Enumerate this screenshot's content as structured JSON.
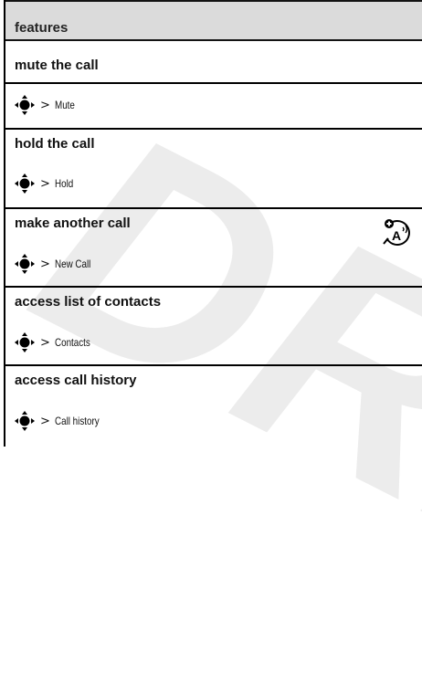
{
  "watermark": "DRA",
  "header": {
    "title": "features"
  },
  "features": [
    {
      "title": "mute the call",
      "separator": ">",
      "menu": "Mute",
      "nav_icon": "navigation-key-icon"
    },
    {
      "title": "hold the call",
      "separator": ">",
      "menu": "Hold",
      "nav_icon": "navigation-key-icon"
    },
    {
      "title": "make another call",
      "separator": ">",
      "menu": "New Call",
      "nav_icon": "navigation-key-icon",
      "extra_icon": "network-feature-icon"
    },
    {
      "title": "access list of contacts",
      "separator": ">",
      "menu": "Contacts",
      "nav_icon": "navigation-key-icon"
    },
    {
      "title": "access call history",
      "separator": ">",
      "menu": "Call history",
      "nav_icon": "navigation-key-icon"
    }
  ]
}
